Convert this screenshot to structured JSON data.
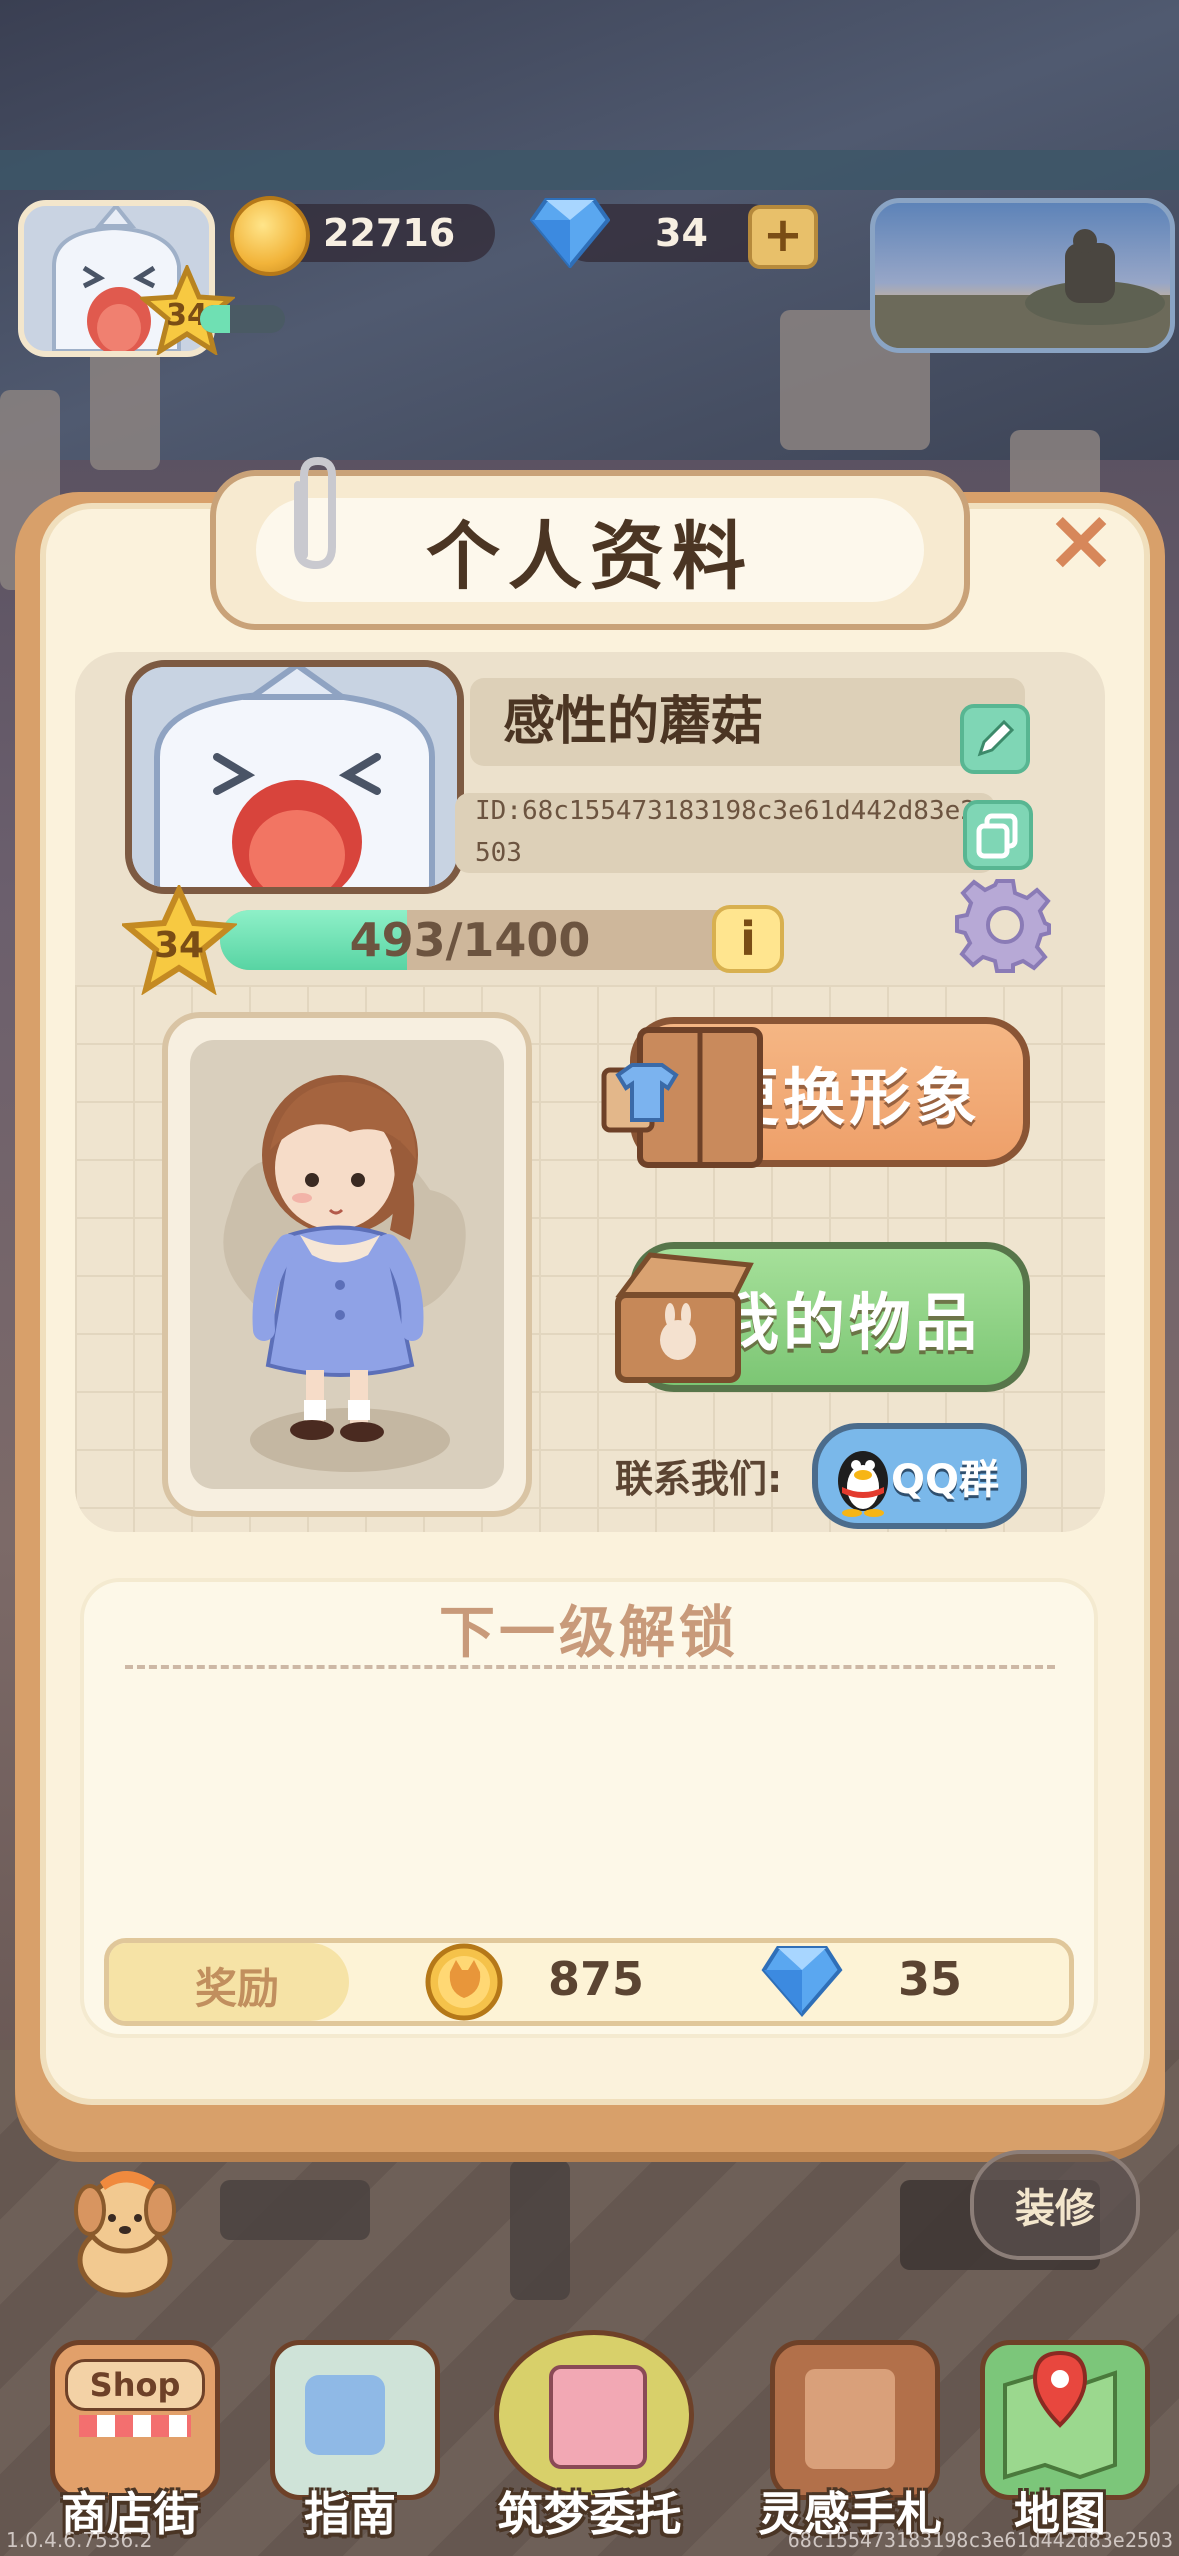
{
  "hud": {
    "level": "34",
    "xp_fraction": 0.35,
    "coins": "22716",
    "gems": "34",
    "plus_label": "+"
  },
  "dialog": {
    "title": "个人资料",
    "close_label": "×"
  },
  "profile": {
    "name": "感性的蘑菇",
    "id_text": "ID:68c155473183198c3e61d442d83e2503",
    "level": "34",
    "xp_text": "493/1400",
    "xp_fraction": 0.352,
    "info_label": "i"
  },
  "actions": {
    "change_look": "更换形象",
    "my_items": "我的物品",
    "contact_label": "联系我们:",
    "qq_group": "QQ群"
  },
  "unlock": {
    "title": "下一级解锁",
    "reward_label": "奖励",
    "reward_coins": "875",
    "reward_gems": "35"
  },
  "nav": {
    "decorate": "装修",
    "items": [
      {
        "label": "商店街",
        "icon_text": "Shop"
      },
      {
        "label": "指南"
      },
      {
        "label": "筑梦委托"
      },
      {
        "label": "灵感手札"
      },
      {
        "label": "地图"
      }
    ]
  },
  "footer": {
    "version": "1.0.4.6.7536.2",
    "device_id": "68c155473183198c3e61d442d83e2503"
  },
  "colors": {
    "panel_border": "#d8a06a",
    "panel_bg": "#fbf2dc",
    "xp_green": "#58d4a3",
    "btn_orange": "#eea06a",
    "btn_green": "#7cc674",
    "qq_blue": "#7ab8ea"
  }
}
